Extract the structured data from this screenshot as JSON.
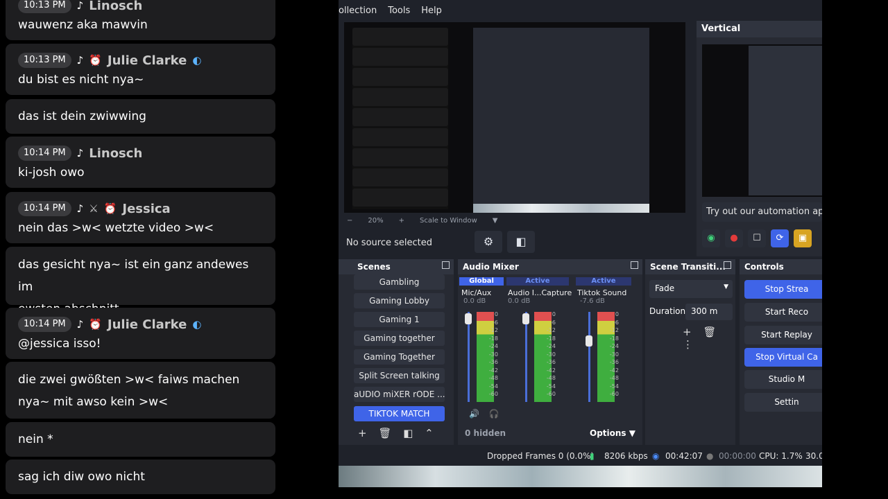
{
  "chat": {
    "messages": [
      {
        "time": "10:13 PM",
        "user": "Linosch",
        "text": "wauwenz aka mawvin"
      },
      {
        "time": "10:13 PM",
        "user": "Julie Clarke",
        "text": "du bist es nicht nya~"
      },
      {
        "time": "",
        "user": "",
        "text": "das ist dein zwiwwing"
      },
      {
        "time": "10:14 PM",
        "user": "Linosch",
        "text": "ki-josh owo"
      },
      {
        "time": "10:14 PM",
        "user": "Jessica",
        "text": "nein das >w< wetzte video >w<"
      },
      {
        "time": "",
        "user": "",
        "text": "das gesicht nya~ ist ein ganz andewes im\newsten abschnitt"
      },
      {
        "time": "10:14 PM",
        "user": "Julie Clarke",
        "text": "@jessica isso!"
      },
      {
        "time": "",
        "user": "",
        "text": "die zwei gwößten >w< faiws machen\nnya~ mit awso kein >w<"
      },
      {
        "time": "",
        "user": "",
        "text": "nein *"
      },
      {
        "time": "",
        "user": "",
        "text": "sag ich diw owo nicht"
      }
    ]
  },
  "obs": {
    "menu": [
      "ollection",
      "Tools",
      "Help"
    ],
    "scale": {
      "zoom": "20%",
      "mode": "Scale to Window"
    },
    "source_label": "No source selected",
    "vertical": {
      "title": "Vertical",
      "automation": "Try out our automation app"
    },
    "scenes": {
      "title": "Scenes",
      "items": [
        "Gambling",
        "Gaming Lobby",
        "Gaming 1",
        "Gaming together",
        "Gaming Together",
        "Split Screen talking",
        "aUDIO miXER rODE ...",
        "TIKTOK MATCH"
      ],
      "selected": "TIKTOK MATCH"
    },
    "mixer": {
      "title": "Audio Mixer",
      "hidden": "0 hidden",
      "options": "Options",
      "channels": [
        {
          "tag": "Global",
          "name": "Mic/Aux",
          "db": "0.0 dB",
          "level": 0.0
        },
        {
          "tag": "Active",
          "name": "Audio I...Capture",
          "db": "0.0 dB",
          "level": 0.0
        },
        {
          "tag": "Active",
          "name": "Tiktok Sound",
          "db": "-7.6 dB",
          "level": -7.6
        }
      ],
      "scale_ticks": [
        "0",
        "-6",
        "-12",
        "-18",
        "-24",
        "-30",
        "-36",
        "-42",
        "-48",
        "-54",
        "-60"
      ]
    },
    "transitions": {
      "title": "Scene Transiti...",
      "selected": "Fade",
      "duration_label": "Duration",
      "duration_value": "300 m"
    },
    "controls": {
      "title": "Controls",
      "buttons": [
        "Stop Strea",
        "Start Reco",
        "Start Replay",
        "Stop Virtual Ca",
        "Studio M",
        "Settin"
      ]
    },
    "status": {
      "dropped": "Dropped Frames 0 (0.0%)",
      "bitrate": "8206 kbps",
      "stream_time": "00:42:07",
      "record_time": "00:00:00",
      "cpu": "CPU: 1.7%",
      "fps": "30.0"
    },
    "colors": {
      "accent": "#3f64e8",
      "panel": "#272a33",
      "panel_title": "#30343f",
      "bg": "#1f222a"
    }
  }
}
